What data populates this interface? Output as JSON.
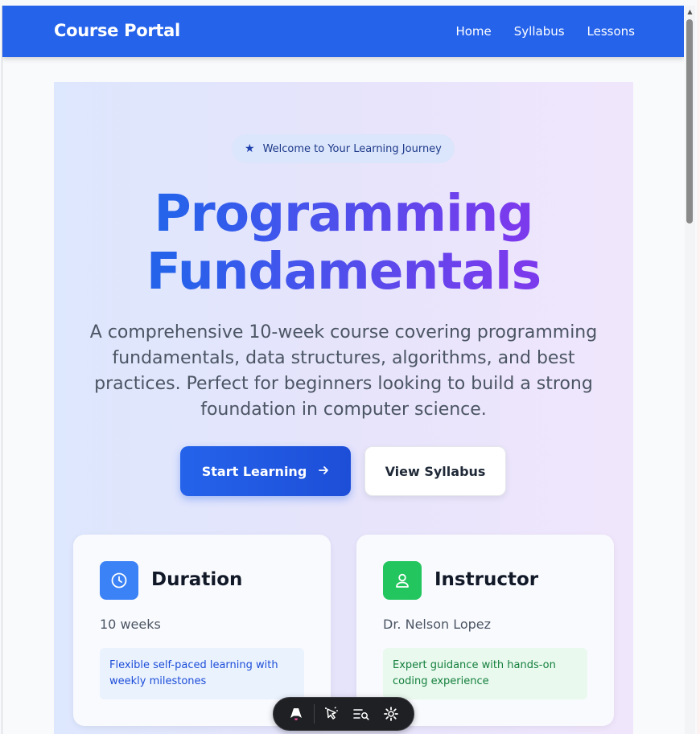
{
  "nav": {
    "brand": "Course Portal",
    "links": [
      "Home",
      "Syllabus",
      "Lessons"
    ]
  },
  "hero": {
    "badge": "Welcome to Your Learning Journey",
    "title_line1": "Programming",
    "title_line2": "Fundamentals",
    "description": "A comprehensive 10-week course covering programming fundamentals, data structures, algorithms, and best practices. Perfect for beginners looking to build a strong foundation in computer science.",
    "primary_button": "Start Learning",
    "secondary_button": "View Syllabus"
  },
  "cards": [
    {
      "title": "Duration",
      "value": "10 weeks",
      "note": "Flexible self-paced learning with weekly milestones",
      "icon": "clock-icon"
    },
    {
      "title": "Instructor",
      "value": "Dr. Nelson Lopez",
      "note": "Expert guidance with hands-on coding experience",
      "icon": "user-icon"
    }
  ],
  "colors": {
    "nav": "#2563eb",
    "primary": "#2563eb",
    "accent_purple": "#7c3aed",
    "green": "#22c55e"
  }
}
